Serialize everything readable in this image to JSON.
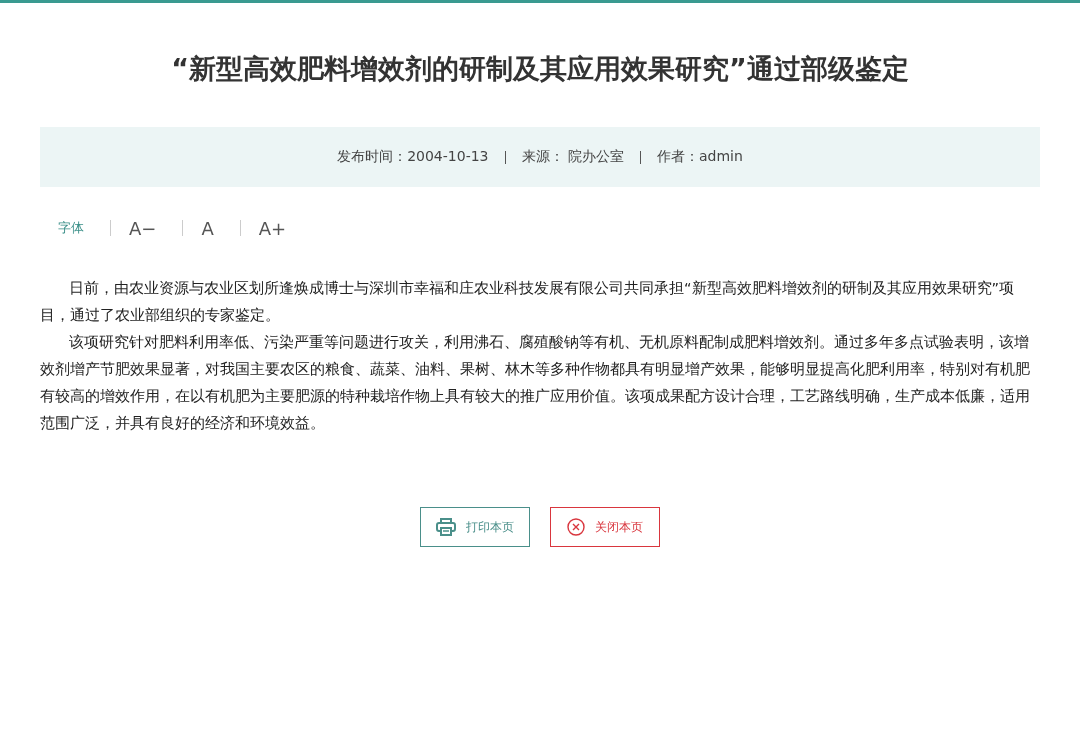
{
  "title": "“新型高效肥料增效剂的研制及其应用效果研究”通过部级鉴定",
  "meta": [
    "发布时间：2004-10-13",
    "来源： 院办公室",
    "作者：admin"
  ],
  "font_tools": {
    "label": "字体",
    "sizes": [
      "A−",
      "A",
      "A+"
    ]
  },
  "paragraphs": [
    "日前，由农业资源与农业区划所逢焕成博士与深圳市幸福和庄农业科技发展有限公司共同承担“新型高效肥料增效剂的研制及其应用效果研究”项目，通过了农业部组织的专家鉴定。",
    "该项研究针对肥料利用率低、污染严重等问题进行攻关，利用沸石、腐殖酸钠等有机、无机原料配制成肥料增效剂。通过多年多点试验表明，该增效剂增产节肥效果显著，对我国主要农区的粮食、蔬菜、油料、果树、林木等多种作物都具有明显增产效果，能够明显提高化肥利用率，特别对有机肥有较高的增效作用，在以有机肥为主要肥源的特种栽培作物上具有较大的推广应用价值。该项成果配方设计合理，工艺路线明确，生产成本低廉，适用范围广泛，并具有良好的经济和环境效益。"
  ],
  "buttons": [
    {
      "kind": "print",
      "label": "打印本页"
    },
    {
      "kind": "close",
      "label": "关闭本页"
    }
  ]
}
